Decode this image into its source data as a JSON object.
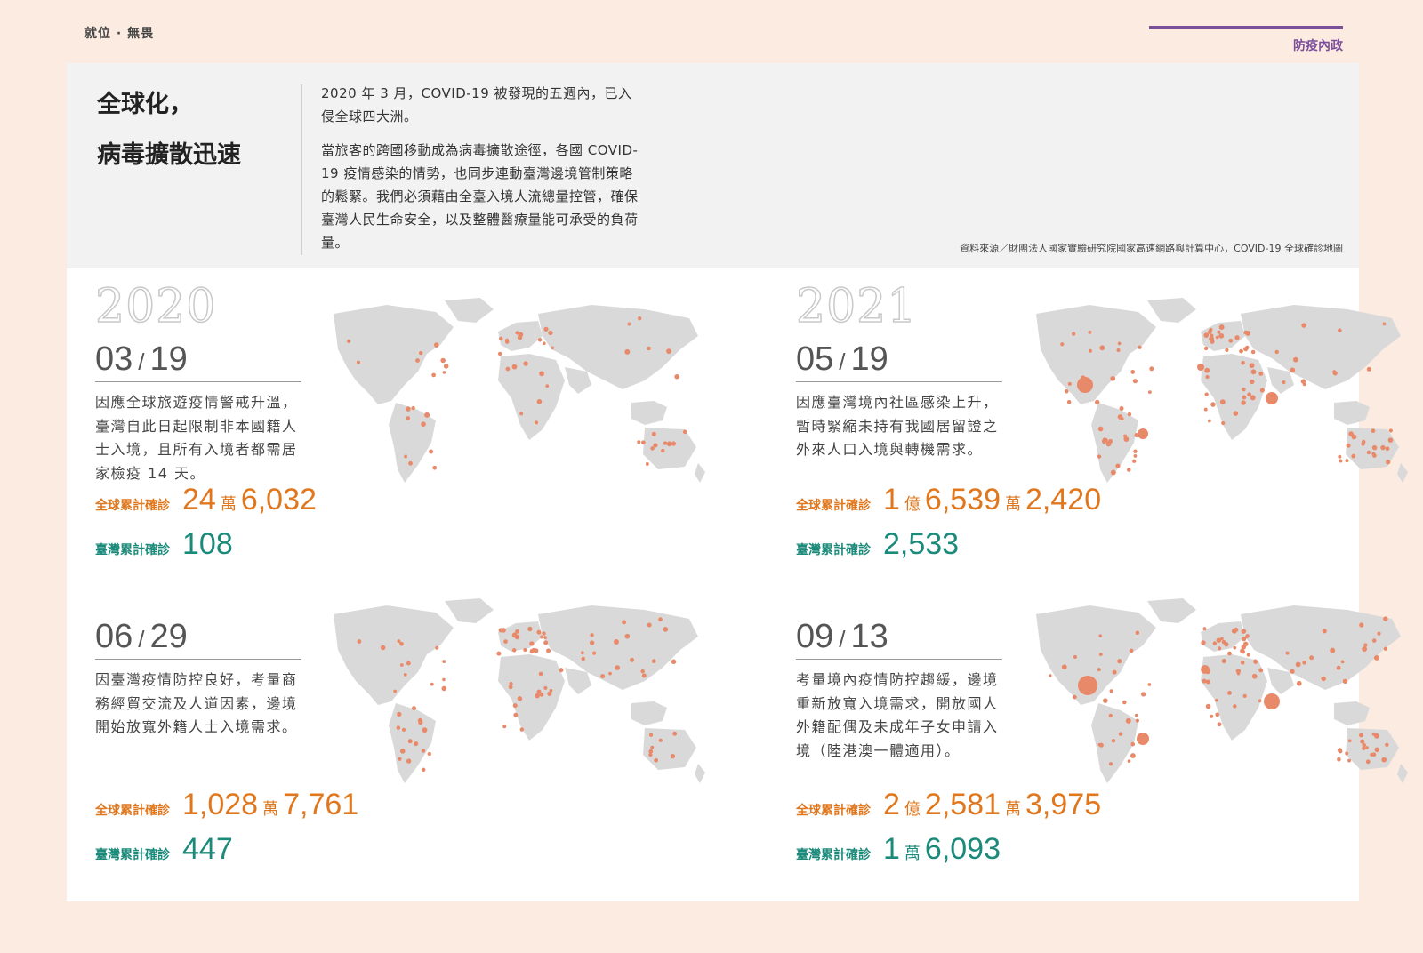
{
  "header": {
    "left": "就位 · 無畏",
    "right": "防疫內政"
  },
  "intro": {
    "title_line1": "全球化，",
    "title_line2": "病毒擴散迅速",
    "para1": "2020 年 3 月，COVID-19 被發現的五週內，已入侵全球四大洲。",
    "para2": "當旅客的跨國移動成為病毒擴散途徑，各國 COVID-19 疫情感染的情勢，也同步連動臺灣邊境管制策略的鬆緊。我們必須藉由全臺入境人流總量控管，確保臺灣人民生命安全，以及整體醫療量能可承受的負荷量。",
    "source": "資料來源／財團法人國家實驗研究院國家高速網路與計算中心，COVID-19 全球確診地圖"
  },
  "years": {
    "left": "2020",
    "right": "2021"
  },
  "labels": {
    "global": "全球累計確診",
    "taiwan": "臺灣累計確診",
    "yi": "億",
    "wan": "萬"
  },
  "events": [
    {
      "month": "03",
      "day": "19",
      "desc": "因應全球旅遊疫情警戒升溫，臺灣自此日起限制非本國籍人士入境，且所有入境者都需居家檢疫 14 天。",
      "global": {
        "yi": "",
        "wan": "24",
        "rest": "6,032"
      },
      "taiwan": {
        "wan": "",
        "rest": "108"
      }
    },
    {
      "month": "06",
      "day": "29",
      "desc": "因臺灣疫情防控良好，考量商務經貿交流及人道因素，邊境開始放寬外籍人士入境需求。",
      "global": {
        "yi": "",
        "wan": "1,028",
        "rest": "7,761"
      },
      "taiwan": {
        "wan": "",
        "rest": "447"
      }
    },
    {
      "month": "05",
      "day": "19",
      "desc": "因應臺灣境內社區感染上升，暫時緊縮未持有我國居留證之外來人口入境與轉機需求。",
      "global": {
        "yi": "1",
        "wan": "6,539",
        "rest": "2,420"
      },
      "taiwan": {
        "wan": "",
        "rest": "2,533"
      }
    },
    {
      "month": "09",
      "day": "13",
      "desc": "考量境內疫情防控趨緩，邊境重新放寬入境需求，開放國人外籍配偶及未成年子女申請入境（陸港澳一體適用）。",
      "global": {
        "yi": "2",
        "wan": "2,581",
        "rest": "3,975"
      },
      "taiwan": {
        "wan": "1",
        "rest": "6,093"
      }
    }
  ],
  "colors": {
    "accent_purple": "#7b4f9c",
    "global_orange": "#e0771d",
    "taiwan_teal": "#1b8a7a",
    "dot": "#e8896a",
    "land": "#d9d9d9"
  }
}
